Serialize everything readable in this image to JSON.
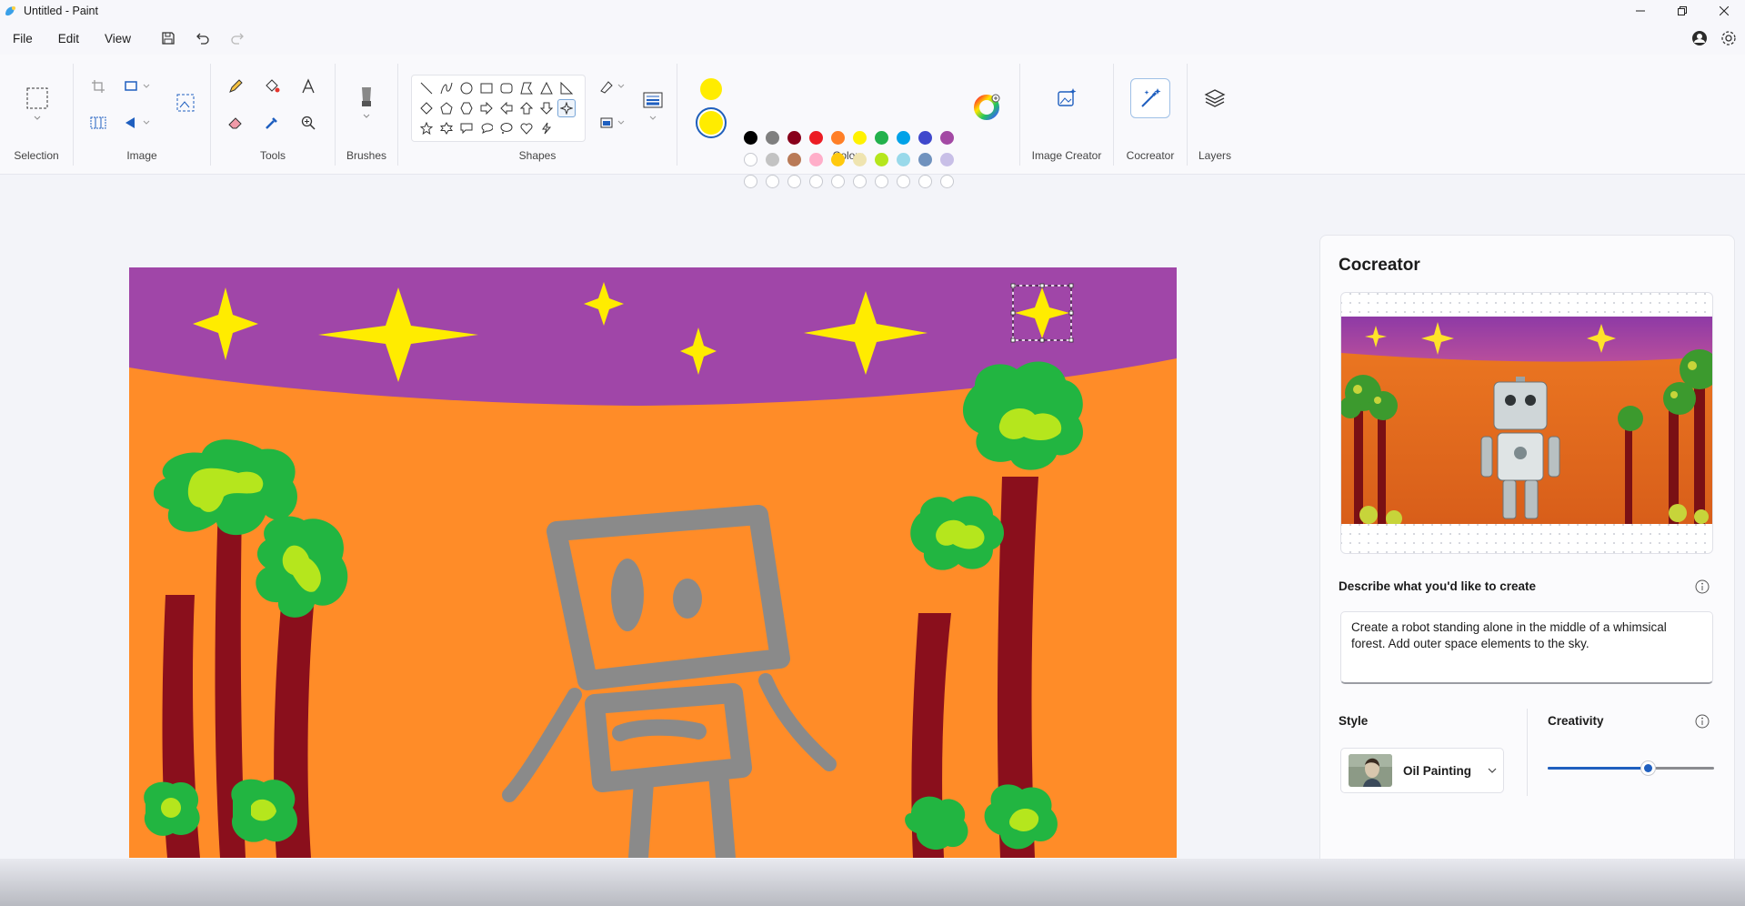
{
  "window": {
    "title": "Untitled - Paint"
  },
  "menu": {
    "file": "File",
    "edit": "Edit",
    "view": "View"
  },
  "ribbon": {
    "groups": {
      "selection": "Selection",
      "image": "Image",
      "tools": "Tools",
      "brushes": "Brushes",
      "shapes": "Shapes",
      "colors": "Colors",
      "image_creator": "Image Creator",
      "cocreator": "Cocreator",
      "layers": "Layers"
    },
    "colors": {
      "primary": "#ffec00",
      "secondary": "#ffec00",
      "palette_row1": [
        "#000000",
        "#7f7f7f",
        "#88001b",
        "#ec1c24",
        "#ff7f27",
        "#fff200",
        "#22b14c",
        "#00a2e8",
        "#3f48cc",
        "#a349a4"
      ],
      "palette_row2": [
        "#ffffff",
        "#c3c3c3",
        "#b97a57",
        "#ffaec9",
        "#ffc90e",
        "#efe4b0",
        "#b5e61d",
        "#99d9ea",
        "#7092be",
        "#c8bfe7"
      ]
    }
  },
  "panel": {
    "title": "Cocreator",
    "describe_label": "Describe what you'd like to create",
    "prompt": "Create a robot standing alone in the middle of a whimsical forest. Add outer space elements to the sky.",
    "style_label": "Style",
    "style_value": "Oil Painting",
    "creativity_label": "Creativity",
    "creativity_value": 0.6
  },
  "canvas": {
    "sky_color": "#a046a8",
    "ground_color": "#ff8c28"
  }
}
